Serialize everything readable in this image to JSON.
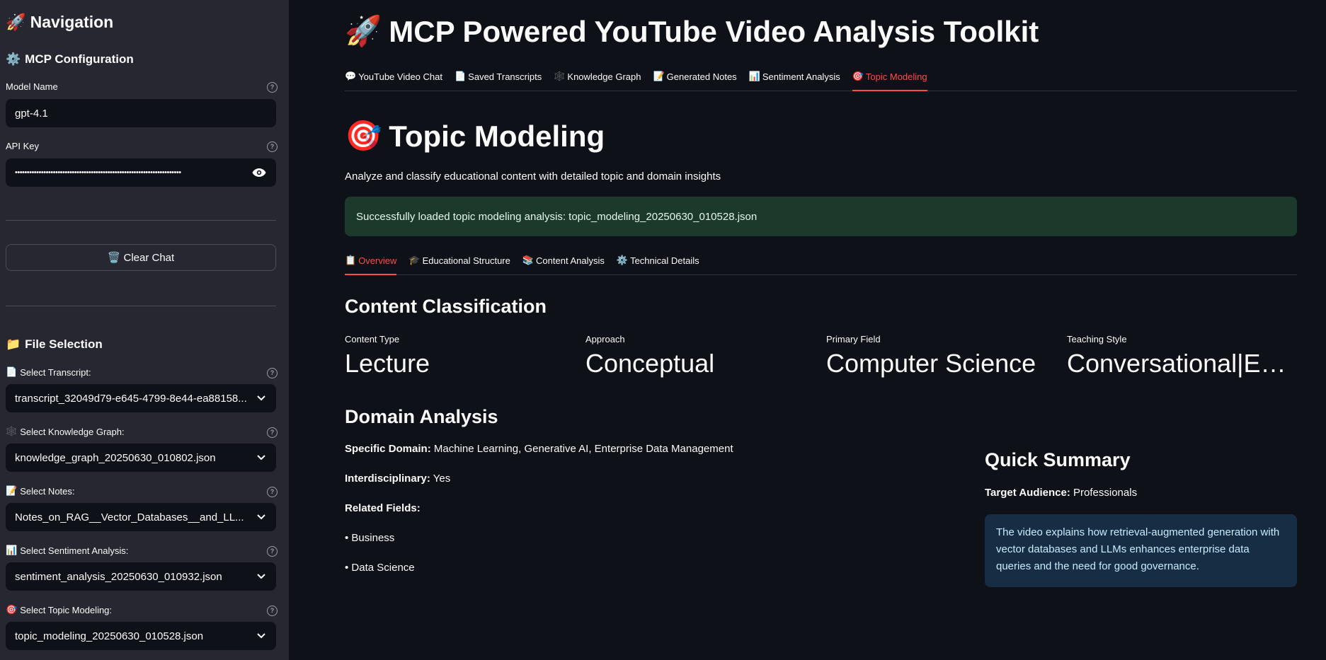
{
  "sidebar": {
    "title_icon": "🚀",
    "title": "Navigation",
    "config_icon": "⚙️",
    "config_heading": "MCP Configuration",
    "model_label": "Model Name",
    "model_value": "gpt-4.1",
    "api_label": "API Key",
    "api_value": "••••••••••••••••••••••••••••••••••••••••••••••••••••••••••••••••••••••",
    "clear_icon": "🗑️",
    "clear_label": "Clear Chat",
    "file_icon": "📁",
    "file_heading": "File Selection",
    "selects": [
      {
        "icon": "📄",
        "label": "Select Transcript:",
        "value": "transcript_32049d79-e645-4799-8e44-ea88158..."
      },
      {
        "icon": "🕸️",
        "label": "Select Knowledge Graph:",
        "value": "knowledge_graph_20250630_010802.json"
      },
      {
        "icon": "📝",
        "label": "Select Notes:",
        "value": "Notes_on_RAG__Vector_Databases__and_LL..."
      },
      {
        "icon": "📊",
        "label": "Select Sentiment Analysis:",
        "value": "sentiment_analysis_20250630_010932.json"
      },
      {
        "icon": "🎯",
        "label": "Select Topic Modeling:",
        "value": "topic_modeling_20250630_010528.json"
      }
    ]
  },
  "header": {
    "icon": "🚀",
    "title": "MCP Powered YouTube Video Analysis Toolkit"
  },
  "tabs": [
    {
      "icon": "💬",
      "label": "YouTube Video Chat"
    },
    {
      "icon": "📄",
      "label": "Saved Transcripts"
    },
    {
      "icon": "🕸️",
      "label": "Knowledge Graph"
    },
    {
      "icon": "📝",
      "label": "Generated Notes"
    },
    {
      "icon": "📊",
      "label": "Sentiment Analysis"
    },
    {
      "icon": "🎯",
      "label": "Topic Modeling"
    }
  ],
  "page": {
    "icon": "🎯",
    "title": "Topic Modeling",
    "subtitle": "Analyze and classify educational content with detailed topic and domain insights",
    "success": "Successfully loaded topic modeling analysis: topic_modeling_20250630_010528.json"
  },
  "subtabs": [
    {
      "icon": "📋",
      "label": "Overview"
    },
    {
      "icon": "🎓",
      "label": "Educational Structure"
    },
    {
      "icon": "📚",
      "label": "Content Analysis"
    },
    {
      "icon": "⚙️",
      "label": "Technical Details"
    }
  ],
  "classification": {
    "heading": "Content Classification",
    "metrics": [
      {
        "label": "Content Type",
        "value": "Lecture"
      },
      {
        "label": "Approach",
        "value": "Conceptual"
      },
      {
        "label": "Primary Field",
        "value": "Computer Science"
      },
      {
        "label": "Teaching Style",
        "value": "Conversational|Exp…"
      }
    ]
  },
  "domain": {
    "heading": "Domain Analysis",
    "specific_label": "Specific Domain:",
    "specific_value": "Machine Learning, Generative AI, Enterprise Data Management",
    "inter_label": "Interdisciplinary:",
    "inter_value": "Yes",
    "related_label": "Related Fields:",
    "related": [
      "• Business",
      "• Data Science"
    ]
  },
  "summary": {
    "heading": "Quick Summary",
    "audience_label": "Target Audience:",
    "audience_value": "Professionals",
    "text": "The video explains how retrieval-augmented generation with vector databases and LLMs enhances enterprise data queries and the need for good governance."
  },
  "colors": {
    "accent": "#ff4b4b",
    "success_bg": "#1c3a2b",
    "info_bg": "#172d43",
    "sidebar_bg": "#262730",
    "main_bg": "#0e1117"
  }
}
